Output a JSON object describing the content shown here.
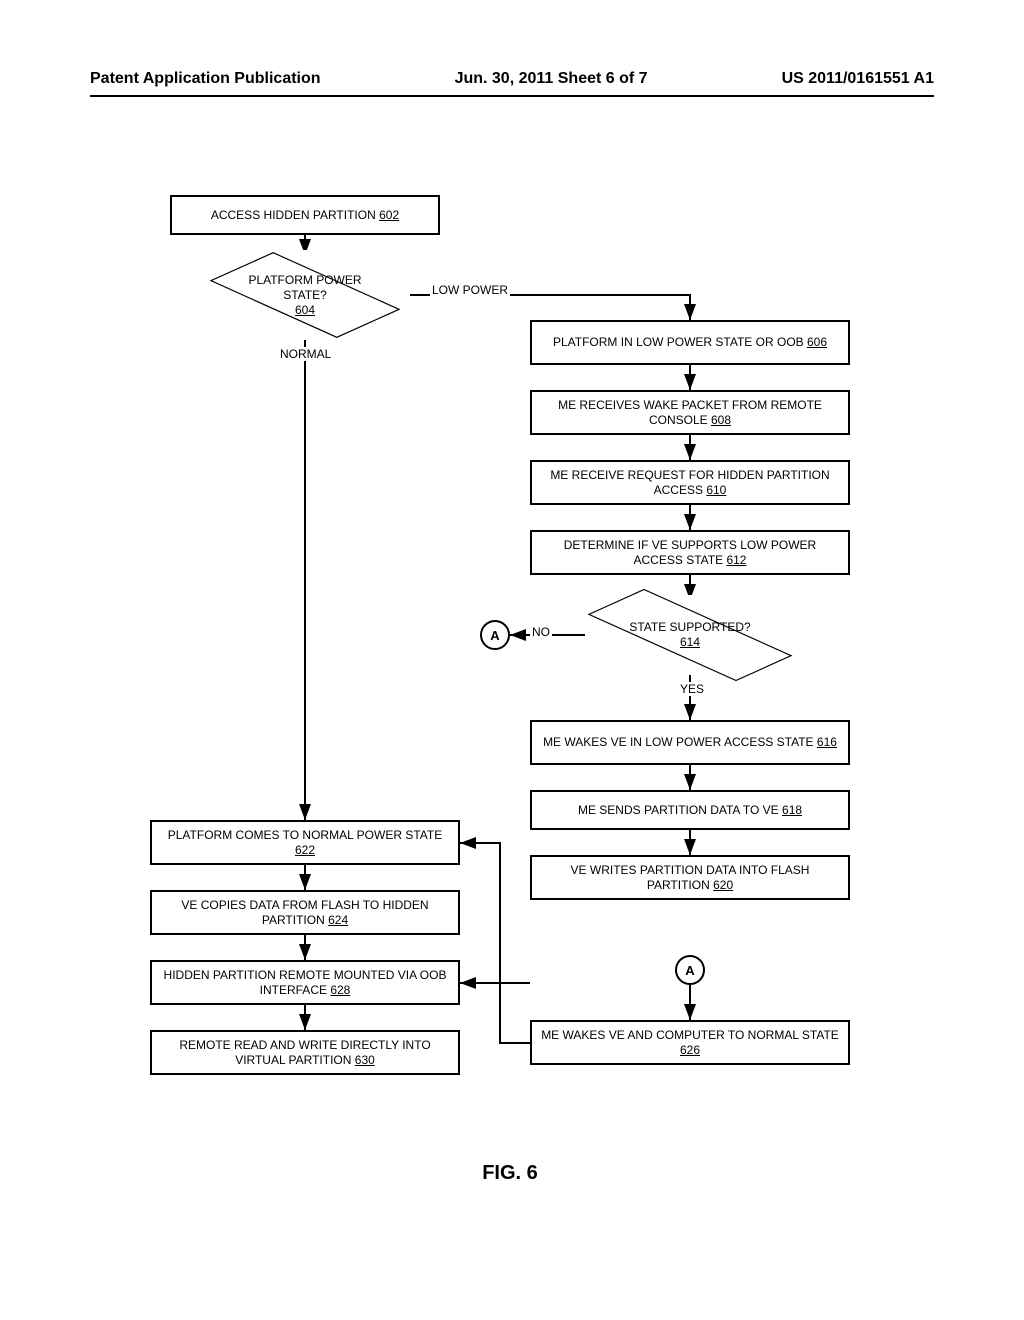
{
  "header": {
    "left": "Patent Application Publication",
    "center": "Jun. 30, 2011  Sheet 6 of 7",
    "right": "US 2011/0161551 A1"
  },
  "figure_caption": "FIG. 6",
  "nodes": {
    "n602": {
      "text": "ACCESS HIDDEN PARTITION",
      "ref": "602"
    },
    "n604": {
      "text": "PLATFORM POWER STATE?",
      "ref": "604"
    },
    "n606": {
      "text": "PLATFORM IN LOW POWER STATE OR OOB",
      "ref": "606"
    },
    "n608": {
      "text": "ME RECEIVES WAKE PACKET FROM REMOTE CONSOLE",
      "ref": "608"
    },
    "n610": {
      "text": "ME RECEIVE REQUEST FOR HIDDEN PARTITION ACCESS",
      "ref": "610"
    },
    "n612": {
      "text": "DETERMINE IF VE SUPPORTS LOW POWER ACCESS STATE",
      "ref": "612"
    },
    "n614": {
      "text": "STATE SUPPORTED?",
      "ref": "614"
    },
    "n616": {
      "text": "ME WAKES VE IN LOW POWER ACCESS STATE",
      "ref": "616"
    },
    "n618": {
      "text": "ME SENDS PARTITION DATA TO VE",
      "ref": "618"
    },
    "n620": {
      "text": "VE WRITES PARTITION DATA INTO FLASH PARTITION",
      "ref": "620"
    },
    "n622": {
      "text": "PLATFORM COMES TO NORMAL POWER STATE",
      "ref": "622"
    },
    "n624": {
      "text": "VE COPIES DATA FROM FLASH TO HIDDEN PARTITION",
      "ref": "624"
    },
    "n626": {
      "text": "ME WAKES VE AND COMPUTER TO NORMAL STATE",
      "ref": "626"
    },
    "n628": {
      "text": "HIDDEN PARTITION REMOTE MOUNTED VIA OOB INTERFACE",
      "ref": "628"
    },
    "n630": {
      "text": "REMOTE READ AND WRITE DIRECTLY INTO VIRTUAL PARTITION",
      "ref": "630"
    }
  },
  "connectors": {
    "A": "A"
  },
  "edge_labels": {
    "low_power": "LOW POWER",
    "normal": "NORMAL",
    "no": "NO",
    "yes": "YES"
  },
  "chart_data": {
    "type": "flowchart",
    "title": "FIG. 6",
    "nodes": [
      {
        "id": "602",
        "label": "ACCESS HIDDEN PARTITION",
        "shape": "process"
      },
      {
        "id": "604",
        "label": "PLATFORM POWER STATE?",
        "shape": "decision"
      },
      {
        "id": "606",
        "label": "PLATFORM IN LOW POWER STATE OR OOB",
        "shape": "process"
      },
      {
        "id": "608",
        "label": "ME RECEIVES WAKE PACKET FROM REMOTE CONSOLE",
        "shape": "process"
      },
      {
        "id": "610",
        "label": "ME RECEIVE REQUEST FOR HIDDEN PARTITION ACCESS",
        "shape": "process"
      },
      {
        "id": "612",
        "label": "DETERMINE IF VE SUPPORTS LOW POWER ACCESS STATE",
        "shape": "process"
      },
      {
        "id": "614",
        "label": "STATE SUPPORTED?",
        "shape": "decision"
      },
      {
        "id": "616",
        "label": "ME WAKES VE IN LOW POWER ACCESS STATE",
        "shape": "process"
      },
      {
        "id": "618",
        "label": "ME SENDS PARTITION DATA TO VE",
        "shape": "process"
      },
      {
        "id": "620",
        "label": "VE WRITES PARTITION DATA INTO FLASH PARTITION",
        "shape": "process"
      },
      {
        "id": "622",
        "label": "PLATFORM COMES TO NORMAL POWER STATE",
        "shape": "process"
      },
      {
        "id": "624",
        "label": "VE COPIES DATA FROM FLASH TO HIDDEN PARTITION",
        "shape": "process"
      },
      {
        "id": "626",
        "label": "ME WAKES VE AND COMPUTER TO NORMAL STATE",
        "shape": "process"
      },
      {
        "id": "628",
        "label": "HIDDEN PARTITION REMOTE MOUNTED VIA OOB INTERFACE",
        "shape": "process"
      },
      {
        "id": "630",
        "label": "REMOTE READ AND WRITE DIRECTLY INTO VIRTUAL PARTITION",
        "shape": "process"
      },
      {
        "id": "A1",
        "label": "A",
        "shape": "connector"
      },
      {
        "id": "A2",
        "label": "A",
        "shape": "connector"
      }
    ],
    "edges": [
      {
        "from": "602",
        "to": "604"
      },
      {
        "from": "604",
        "to": "606",
        "label": "LOW POWER"
      },
      {
        "from": "604",
        "to": "622",
        "label": "NORMAL"
      },
      {
        "from": "606",
        "to": "608"
      },
      {
        "from": "608",
        "to": "610"
      },
      {
        "from": "610",
        "to": "612"
      },
      {
        "from": "612",
        "to": "614"
      },
      {
        "from": "614",
        "to": "A1",
        "label": "NO"
      },
      {
        "from": "614",
        "to": "616",
        "label": "YES"
      },
      {
        "from": "616",
        "to": "618"
      },
      {
        "from": "618",
        "to": "620"
      },
      {
        "from": "620",
        "to": "A2"
      },
      {
        "from": "A2",
        "to": "626"
      },
      {
        "from": "626",
        "to": "622"
      },
      {
        "from": "622",
        "to": "624"
      },
      {
        "from": "624",
        "to": "628"
      },
      {
        "from": "628",
        "to": "630"
      }
    ]
  }
}
